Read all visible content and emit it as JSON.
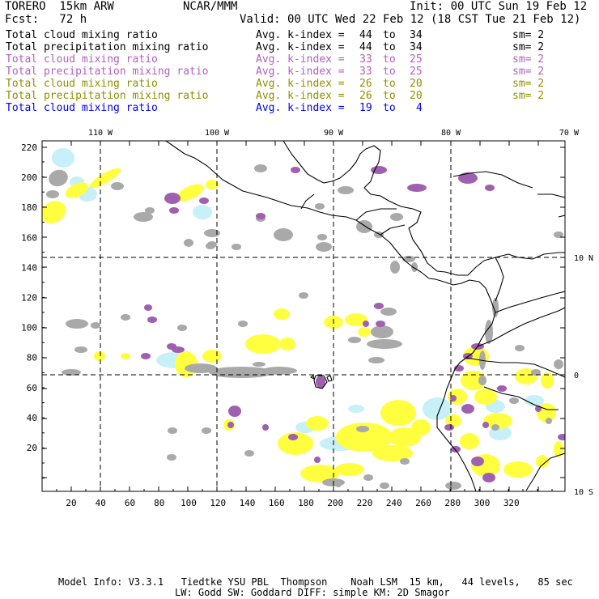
{
  "header": {
    "model": "TORERO  15km ARW",
    "org": "NCAR/MMM",
    "init": "Init: 00 UTC Sun 19 Feb 12",
    "fcst": "Fcst:   72 h",
    "valid": "Valid: 00 UTC Wed 22 Feb 12 (18 CST Tue 21 Feb 12)"
  },
  "legend": [
    {
      "field": "Total cloud mixing ratio",
      "kindex": "Avg. k-index =",
      "from": "44",
      "to_label": "to",
      "to": "34",
      "sm": "sm= 2",
      "color": "#000000"
    },
    {
      "field": "Total precipitation mixing ratio",
      "kindex": "Avg. k-index =",
      "from": "44",
      "to_label": "to",
      "to": "34",
      "sm": "sm= 2",
      "color": "#000000"
    },
    {
      "field": "Total cloud mixing ratio",
      "kindex": "Avg. k-index =",
      "from": "33",
      "to_label": "to",
      "to": "25",
      "sm": "sm= 2",
      "color": "#b060c0"
    },
    {
      "field": "Total precipitation mixing ratio",
      "kindex": "Avg. k-index =",
      "from": "33",
      "to_label": "to",
      "to": "25",
      "sm": "sm= 2",
      "color": "#b060c0"
    },
    {
      "field": "Total cloud mixing ratio",
      "kindex": "Avg. k-index =",
      "from": "26",
      "to_label": "to",
      "to": "20",
      "sm": "sm= 2",
      "color": "#909000"
    },
    {
      "field": "Total precipitation mixing ratio",
      "kindex": "Avg. k-index =",
      "from": "26",
      "to_label": "to",
      "to": "20",
      "sm": "sm= 2",
      "color": "#909000"
    },
    {
      "field": "Total cloud mixing ratio",
      "kindex": "Avg. k-index =",
      "from": "19",
      "to_label": "to",
      "to": "4",
      "sm": "",
      "color": "#0000ff"
    }
  ],
  "map": {
    "lon_labels": [
      "110 W",
      "100 W",
      "90 W",
      "80 W",
      "70 W"
    ],
    "lat_labels": [
      "10 N",
      "0",
      "10 S"
    ],
    "x_ticks": [
      "20",
      "40",
      "60",
      "80",
      "100",
      "120",
      "140",
      "160",
      "180",
      "200",
      "220",
      "240",
      "260",
      "280",
      "300",
      "320"
    ],
    "y_ticks": [
      "220",
      "200",
      "180",
      "160",
      "140",
      "120",
      "100",
      "80",
      "60",
      "40",
      "20"
    ],
    "colors": {
      "gray": "#a9a9a9",
      "purple": "#a060b0",
      "yellow": "#ffff40",
      "lightblue": "#c8f0f8"
    }
  },
  "footer": {
    "line1": "Model Info: V3.3.1   Tiedtke YSU PBL  Thompson    Noah LSM  15 km,   44 levels,   85 sec",
    "line2": "LW: Godd SW: Goddard DIFF: simple KM: 2D Smagor"
  }
}
